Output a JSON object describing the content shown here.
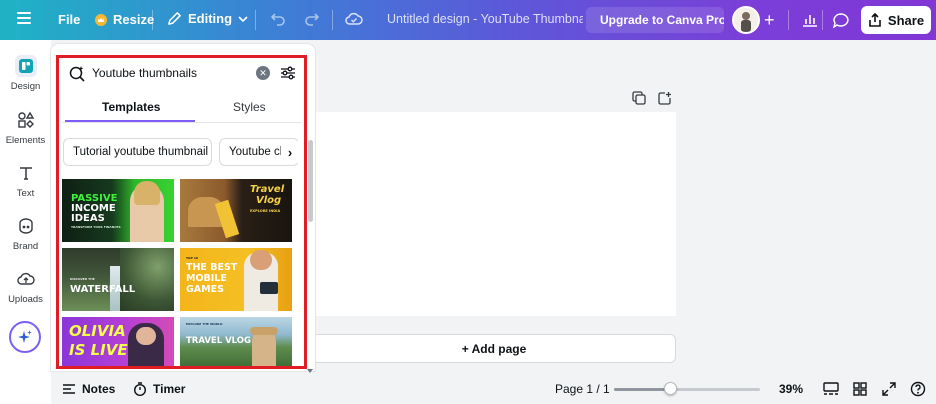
{
  "topbar": {
    "file_label": "File",
    "resize_label": "Resize",
    "editing_label": "Editing",
    "title": "Untitled design - YouTube Thumbnail",
    "upgrade_label": "Upgrade to Canva Pro",
    "share_label": "Share"
  },
  "rail": {
    "items": [
      {
        "label": "Design",
        "icon": "design-icon"
      },
      {
        "label": "Elements",
        "icon": "elements-icon"
      },
      {
        "label": "Text",
        "icon": "text-icon"
      },
      {
        "label": "Brand",
        "icon": "brand-icon"
      },
      {
        "label": "Uploads",
        "icon": "uploads-icon"
      }
    ]
  },
  "panel": {
    "search_value": "Youtube thumbnails",
    "tabs": [
      "Templates",
      "Styles"
    ],
    "chips": [
      "Tutorial youtube thumbnail",
      "Youtube channel"
    ],
    "thumbnails": [
      {
        "lines": [
          "PASSIVE",
          "INCOME",
          "IDEAS"
        ],
        "sub": "TRANSFORM YOUR FINANCES"
      },
      {
        "lines": [
          "Travel",
          "Vlog"
        ],
        "sub": "EXPLORE INDIA"
      },
      {
        "lines": [
          "WATERFALL"
        ],
        "sub": "DISCOVER THE"
      },
      {
        "lines": [
          "THE BEST",
          "MOBILE",
          "GAMES"
        ],
        "sub": "TOP 10"
      },
      {
        "lines": [
          "OLIVIA",
          "IS LIVE"
        ],
        "sub": ""
      },
      {
        "lines": [
          "TRAVEL VLOG"
        ],
        "sub": "EXPLORE THE WORLD"
      }
    ]
  },
  "canvas": {
    "add_page_label": "+ Add page"
  },
  "bottombar": {
    "notes_label": "Notes",
    "timer_label": "Timer",
    "page_label": "Page 1 / 1",
    "zoom_label": "39%",
    "zoom_value": 0.39
  },
  "colors": {
    "accent": "#7d5ff5",
    "highlight": "#e01c24"
  }
}
